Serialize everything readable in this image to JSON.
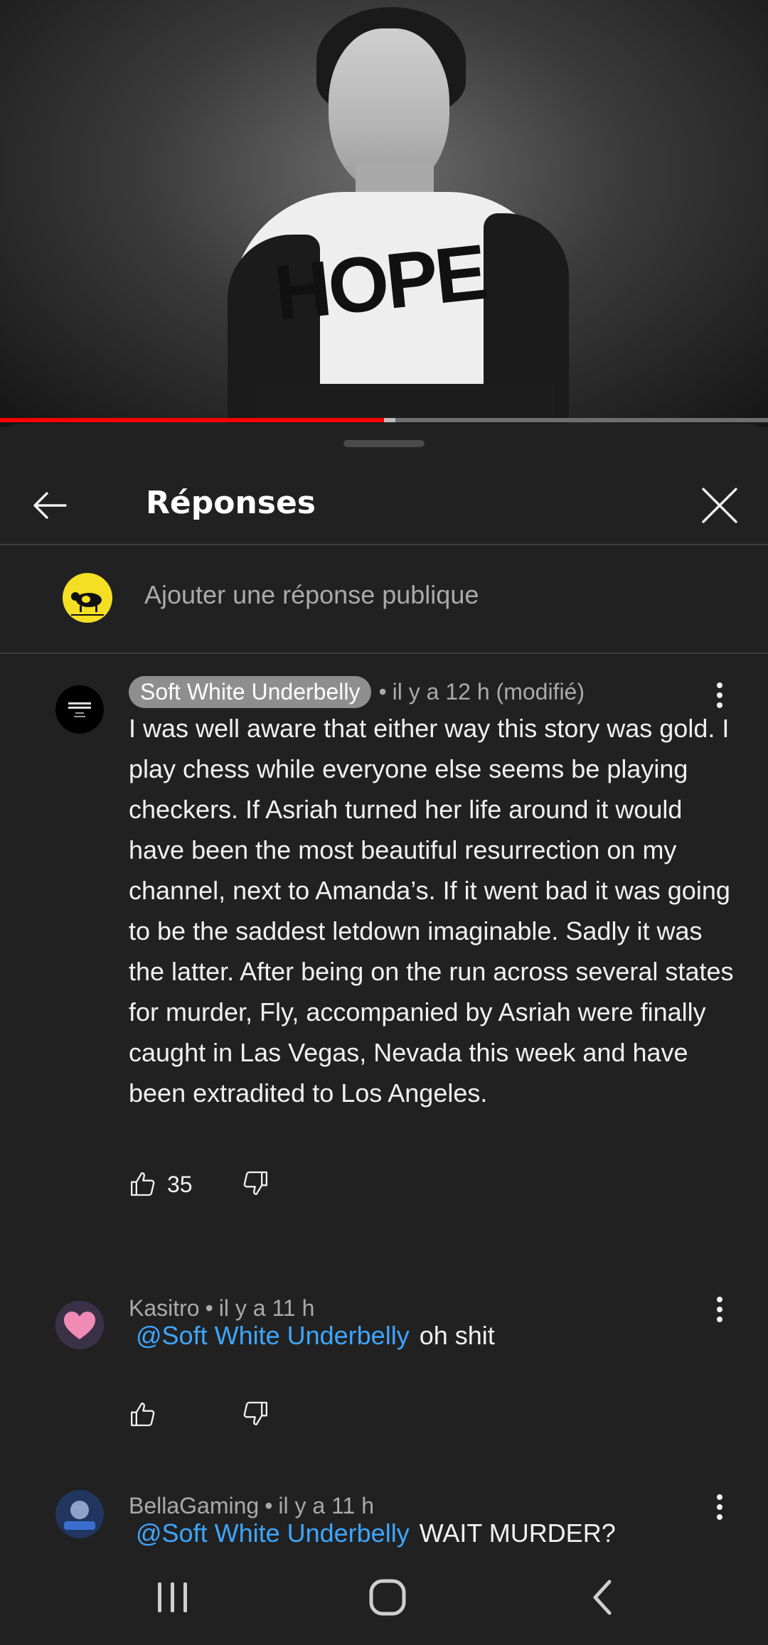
{
  "video": {
    "shirt_text": "HOPE",
    "progress_fraction": 0.5
  },
  "panel": {
    "title": "Réponses",
    "reply_placeholder": "Ajouter une réponse publique"
  },
  "comments": [
    {
      "author": "Soft White Underbelly",
      "author_is_creator": true,
      "time": "il y a 12 h (modifié)",
      "text": "I was well aware that either way this story was gold. I play chess while everyone else seems be playing checkers. If Asriah turned her life around it would have been the most beautiful resurrection on my channel, next to Amanda’s. If it went bad it was going to be the saddest letdown imaginable. Sadly it was the latter. After being on the run across several states for murder, Fly, accompanied by Asriah were finally caught in Las Vegas, Nevada this week and have been extradited to Los Angeles.",
      "likes": "35"
    },
    {
      "author": "Kasitro",
      "time": "il y a 11 h",
      "mention": "@Soft White Underbelly",
      "text": "oh shit",
      "likes": ""
    },
    {
      "author": "BellaGaming",
      "time": "il y a 11 h",
      "mention": "@Soft White Underbelly",
      "text": "WAIT MURDER?",
      "likes": ""
    }
  ],
  "colors": {
    "background": "#212121",
    "progress": "#ff0000",
    "mention": "#3ea6ff",
    "secondary_text": "#aaaaaa"
  },
  "icons": [
    "back-arrow-icon",
    "close-icon",
    "more-vert-icon",
    "thumb-up-icon",
    "thumb-down-icon",
    "recents-icon",
    "home-icon",
    "nav-back-icon"
  ]
}
